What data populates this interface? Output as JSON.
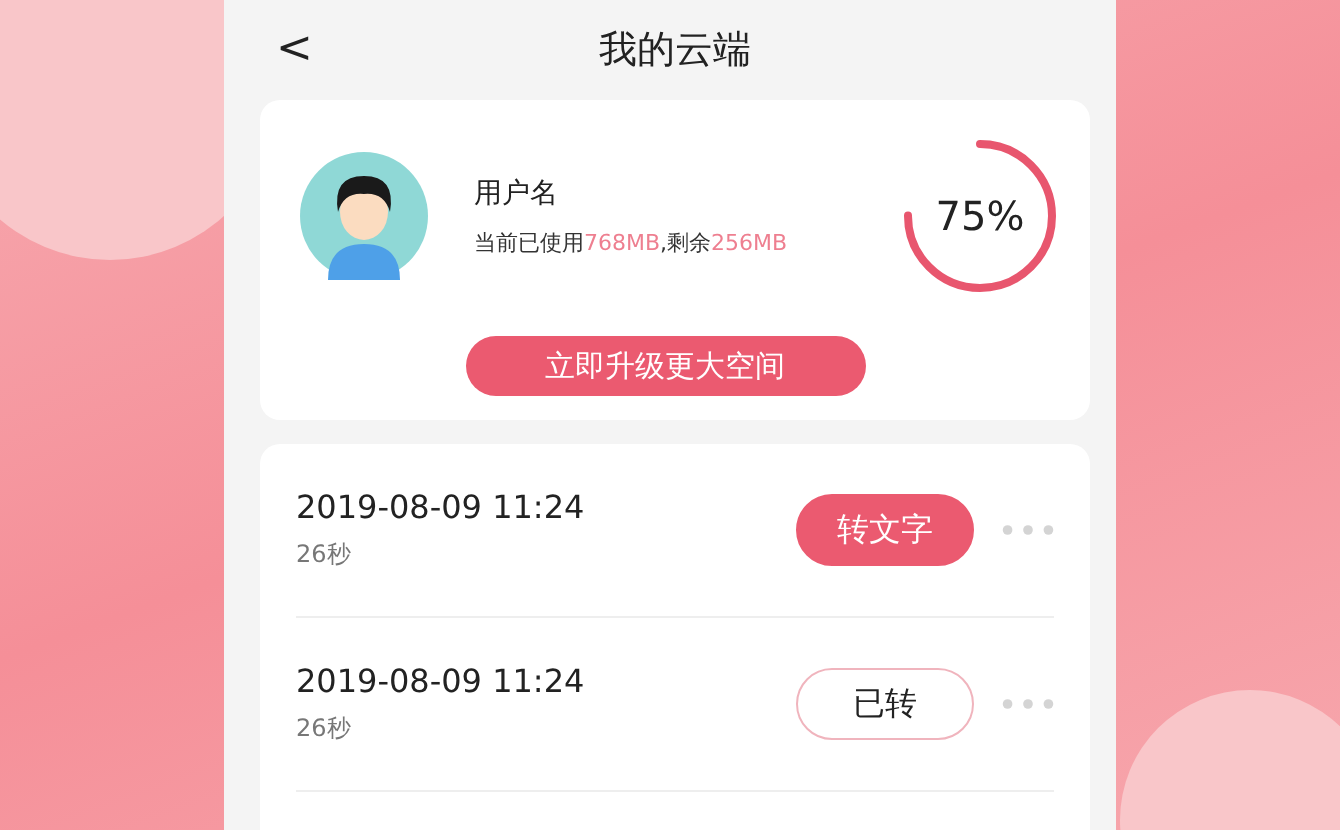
{
  "header": {
    "back": "<",
    "title": "我的云端"
  },
  "profile": {
    "username": "用户名",
    "storage": {
      "prefix": "当前已使用",
      "used": "768MB",
      "separator": ",剩余",
      "remaining": "256MB"
    },
    "usage": {
      "level": 0.75,
      "reading": "75%"
    },
    "upgrade_button": "立即升级更大空间"
  },
  "records": [
    {
      "datetime": "2019-08-09 11:24",
      "duration": "26秒",
      "action": "转文字",
      "converted": false
    },
    {
      "datetime": "2019-08-09 11:24",
      "duration": "26秒",
      "action": "已转",
      "converted": true
    }
  ]
}
